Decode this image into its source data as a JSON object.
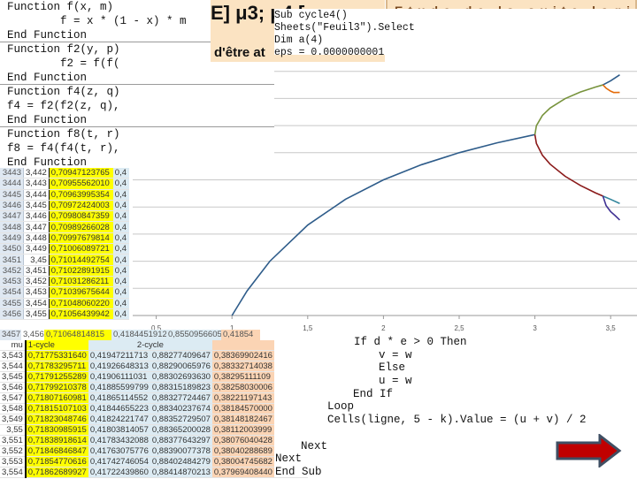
{
  "header_box": {
    "title": "E] μ3; μ4 [",
    "subtitle": "d'être at"
  },
  "functions_code": [
    "Function f(x, m)",
    "        f = x * (1 - x) * m",
    "End Function",
    "Function f2(y, p)",
    "        f2 = f(f(",
    "End Function",
    "Function f4(z, q)",
    "f4 = f2(f2(z, q),",
    "End Function",
    "Function f8(t, r)",
    "f8 = f4(f4(t, r),",
    "End Function"
  ],
  "sub_code": [
    "Sub cycle4()",
    "Sheets(\"Feuil3\").Select",
    "Dim a(4)",
    "eps = 0.0000000001"
  ],
  "loop_code": [
    "If d * e > 0 Then",
    "v = w",
    "Else",
    "u = w",
    "End If",
    "Loop",
    "Cells(ligne, 5 - k).Value = (u + v) / 2",
    "Next",
    "Next",
    "End Sub"
  ],
  "top_table": {
    "rows": [
      [
        "3443",
        "3,442",
        "0,70947123765",
        "0,4"
      ],
      [
        "3444",
        "3,443",
        "0,70955562010",
        "0,4"
      ],
      [
        "3445",
        "3,444",
        "0,70963995354",
        "0,4"
      ],
      [
        "3446",
        "3,445",
        "0,70972424003",
        "0,4"
      ],
      [
        "3447",
        "3,446",
        "0,70980847359",
        "0,4"
      ],
      [
        "3448",
        "3,447",
        "0,70989266028",
        "0,4"
      ],
      [
        "3449",
        "3,448",
        "0,70997679814",
        "0,4"
      ],
      [
        "3450",
        "3,449",
        "0,71006089721",
        "0,4"
      ],
      [
        "3451",
        "3,45",
        "0,71014492754",
        "0,4"
      ],
      [
        "3452",
        "3,451",
        "0,71022891915",
        "0,4"
      ],
      [
        "3453",
        "3,452",
        "0,71031286211",
        "0,4"
      ],
      [
        "3454",
        "3,453",
        "0,71039675644",
        "0,4"
      ],
      [
        "3455",
        "3,454",
        "0,71048060220",
        "0,4"
      ],
      [
        "3456",
        "3,455",
        "0,71056439942",
        "0,4"
      ]
    ],
    "wide_row": [
      "3457",
      "3,456",
      "0,71064814815",
      "0,41844519129",
      "0,85509566056",
      "0,41854"
    ]
  },
  "bottom_table": {
    "headers": [
      "mu",
      "1-cycle",
      "2-cycle",
      ""
    ],
    "rows": [
      [
        "3,543",
        "0,71775331640",
        "0,41947211713",
        "0,88277409647",
        "0,38369902416",
        "0,41947"
      ],
      [
        "3,544",
        "0,71783295711",
        "0,41926648313",
        "0,88290065976",
        "0,38332714038",
        "0,41926"
      ],
      [
        "3,545",
        "0,71791255289",
        "0,41906111031",
        "0,88302693630",
        "0,38295111109",
        "0,41906"
      ],
      [
        "3,546",
        "0,71799210378",
        "0,41885599799",
        "0,88315189823",
        "0,38258030006",
        "0,41885"
      ],
      [
        "3,547",
        "0,71807160981",
        "0,41865114552",
        "0,88327724467",
        "0,38221197143",
        "0,41865"
      ],
      [
        "3,548",
        "0,71815107103",
        "0,41844655223",
        "0,88340237674",
        "0,38184570000",
        "0,41844"
      ],
      [
        "3,549",
        "0,71823048746",
        "0,41824221747",
        "0,88352729507",
        "0,38148182467",
        "0,41824"
      ],
      [
        "3,55",
        "0,71830985915",
        "0,41803814057",
        "0,88365200028",
        "0,38112003999",
        "0,41803"
      ],
      [
        "3,551",
        "0,71838918614",
        "0,41783432088",
        "0,88377643297",
        "0,38076040428",
        "0,41783"
      ],
      [
        "3,552",
        "0,71846846847",
        "0,41763075776",
        "0,88390077378",
        "0,38040288689",
        "0,41763"
      ],
      [
        "3,553",
        "0,71854770616",
        "0,41742746054",
        "0,88402484279",
        "0,38004745682",
        "0,41742"
      ],
      [
        "3,554",
        "0,71862689927",
        "0,41722439860",
        "0,88414870213",
        "0,37969408440",
        "0,41722"
      ]
    ]
  },
  "colors": {
    "one_cycle": "#ffff00",
    "two_cycle": "#dcebf3",
    "four_cycle": "#fbd4b4",
    "arrow": "#c00000",
    "arrow_border": "#3f4f63"
  },
  "next_arrow_icon": "arrow-right-icon",
  "chart_data": {
    "type": "line",
    "title": "",
    "xlabel": "",
    "ylabel": "",
    "xlim": [
      0,
      3.6
    ],
    "ylim": [
      0,
      1
    ],
    "x_ticks": [
      "0,5",
      "1",
      "1,5",
      "2",
      "2,5",
      "3",
      "3,5"
    ],
    "x_tick_values": [
      0.5,
      1,
      1.5,
      2,
      2.5,
      3,
      3.5
    ],
    "grid": true,
    "series": [
      {
        "color": "#2e5c8a",
        "points": [
          [
            1,
            0
          ],
          [
            1.1,
            0.0909
          ],
          [
            1.25,
            0.2
          ],
          [
            1.5,
            0.3333
          ],
          [
            1.75,
            0.4286
          ],
          [
            2,
            0.5
          ],
          [
            2.25,
            0.5556
          ],
          [
            2.5,
            0.6
          ],
          [
            2.75,
            0.6364
          ],
          [
            3,
            0.6667
          ]
        ]
      },
      {
        "color": "#77933c",
        "points": [
          [
            3,
            0.6667
          ],
          [
            3.01,
            0.6998
          ],
          [
            3.05,
            0.7377
          ],
          [
            3.1,
            0.7646
          ],
          [
            3.2,
            0.7995
          ],
          [
            3.3,
            0.8236
          ],
          [
            3.4,
            0.8421
          ],
          [
            3.449,
            0.8499
          ]
        ]
      },
      {
        "color": "#8b1a1a",
        "points": [
          [
            3,
            0.6667
          ],
          [
            3.01,
            0.6338
          ],
          [
            3.05,
            0.5902
          ],
          [
            3.1,
            0.558
          ],
          [
            3.2,
            0.513
          ],
          [
            3.3,
            0.4794
          ],
          [
            3.4,
            0.452
          ],
          [
            3.449,
            0.4401
          ]
        ]
      },
      {
        "color": "#2e5c8a",
        "points": [
          [
            3.449,
            0.8499
          ],
          [
            3.5,
            0.865
          ],
          [
            3.56,
            0.887
          ]
        ]
      },
      {
        "color": "#e46c0a",
        "points": [
          [
            3.449,
            0.8499
          ],
          [
            3.47,
            0.838
          ],
          [
            3.5,
            0.827
          ],
          [
            3.52,
            0.822
          ],
          [
            3.56,
            0.8224
          ]
        ]
      },
      {
        "color": "#31859c",
        "points": [
          [
            3.449,
            0.4401
          ],
          [
            3.5,
            0.4281
          ],
          [
            3.56,
            0.413
          ]
        ]
      },
      {
        "color": "#403294",
        "points": [
          [
            3.449,
            0.4401
          ],
          [
            3.47,
            0.405
          ],
          [
            3.5,
            0.383
          ],
          [
            3.53,
            0.368
          ],
          [
            3.56,
            0.352
          ]
        ]
      }
    ]
  }
}
